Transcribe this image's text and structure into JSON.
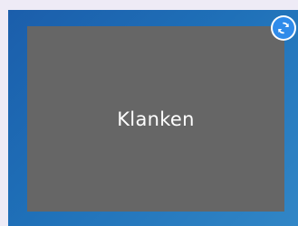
{
  "card": {
    "label": "Klanken",
    "colors": {
      "background": "#1f70b8",
      "panel": "#666666",
      "accent": "#2f8bea"
    }
  },
  "icons": {
    "refresh": "refresh-icon"
  }
}
